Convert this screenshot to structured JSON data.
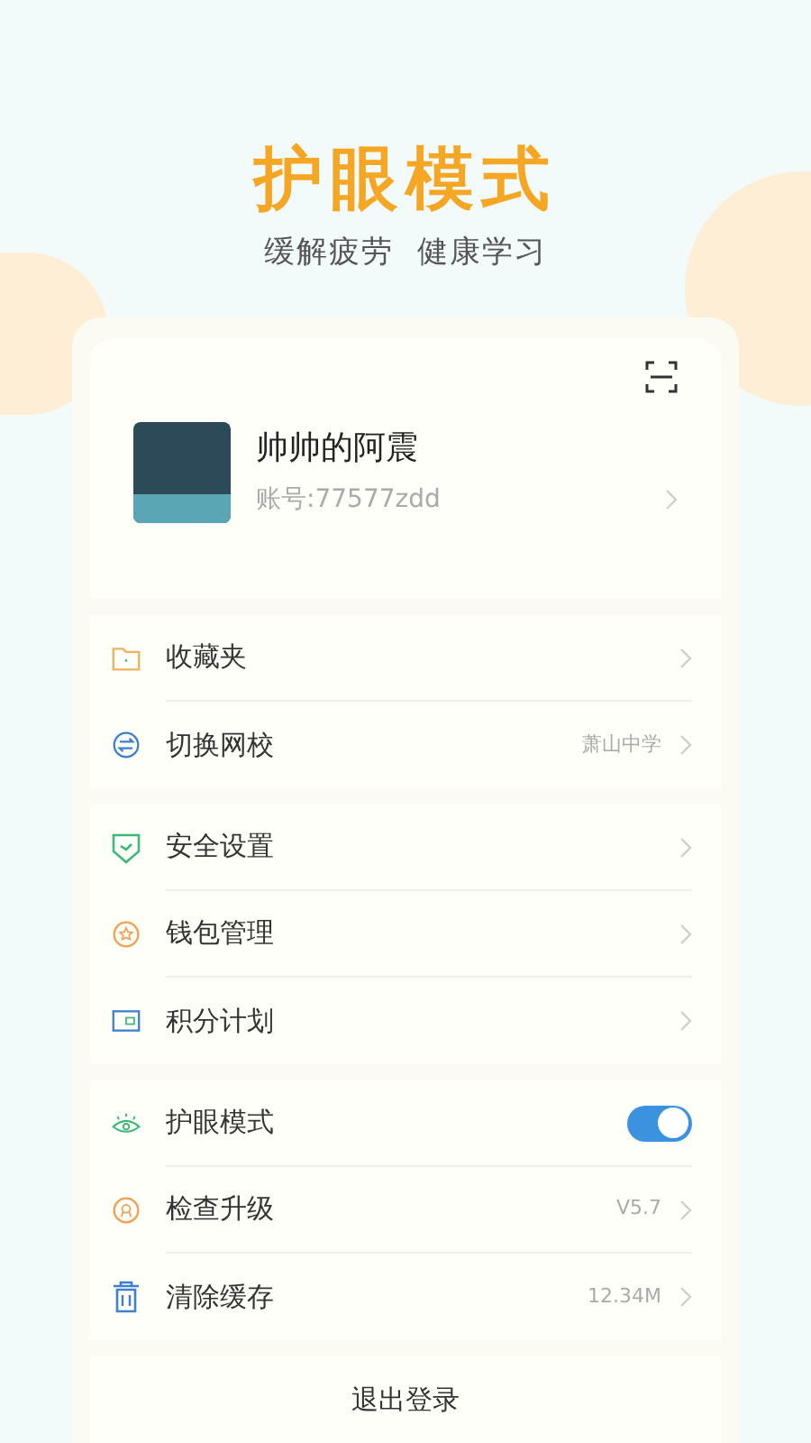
{
  "banner": {
    "title": "护眼模式",
    "subtitle": "缓解疲劳  健康学习"
  },
  "profile": {
    "name": "帅帅的阿震",
    "account": "账号:77577zdd"
  },
  "groups": [
    [
      {
        "kind": "nav",
        "label": "收藏夹"
      },
      {
        "kind": "nav",
        "label": "切换网校",
        "value": "萧山中学"
      }
    ],
    [
      {
        "kind": "nav",
        "label": "安全设置"
      },
      {
        "kind": "nav",
        "label": "钱包管理"
      },
      {
        "kind": "nav",
        "label": "积分计划"
      }
    ],
    [
      {
        "kind": "toggle",
        "label": "护眼模式",
        "on": true
      },
      {
        "kind": "nav",
        "label": "检查升级",
        "value": "V5.7"
      },
      {
        "kind": "nav",
        "label": "清除缓存",
        "value": "12.34M"
      }
    ]
  ],
  "logout": "退出登录"
}
